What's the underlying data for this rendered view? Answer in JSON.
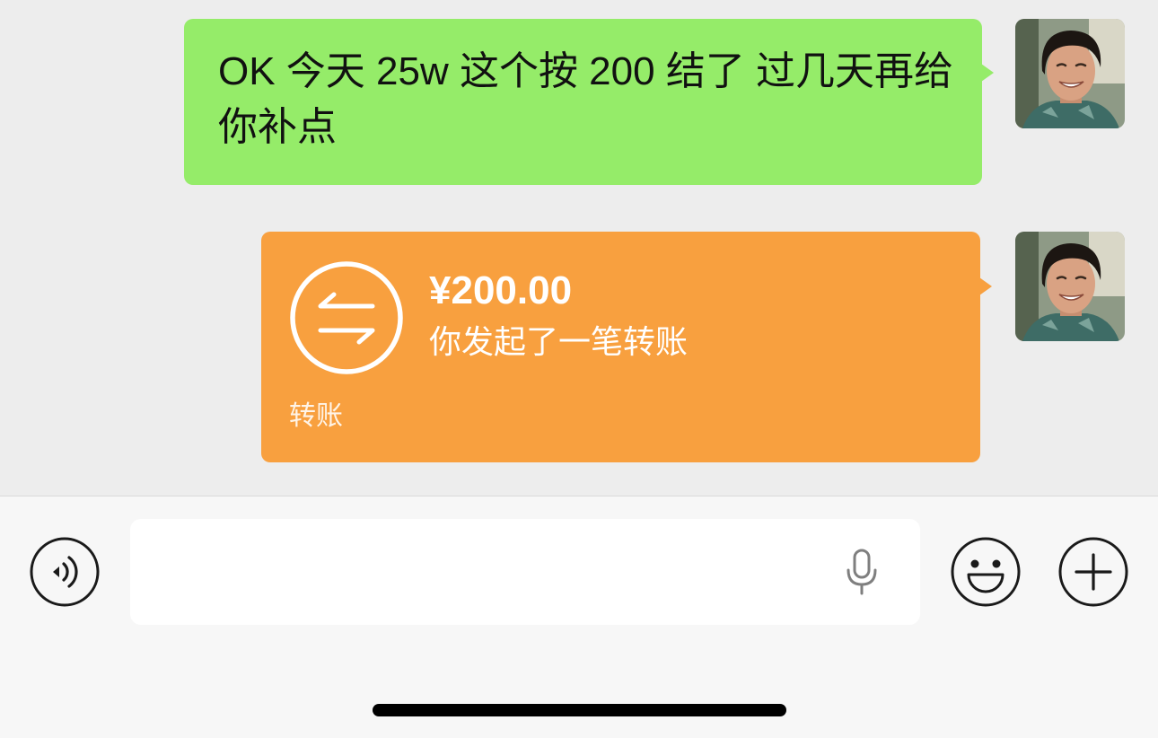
{
  "chat": {
    "text_message": {
      "text": "OK 今天 25w 这个按 200 结了 过几天再给你补点",
      "avatar_icon": "avatar-photo"
    },
    "transfer_message": {
      "amount": "¥200.00",
      "status": "你发起了一笔转账",
      "label": "转账",
      "icon": "transfer-icon",
      "avatar_icon": "avatar-photo"
    }
  },
  "input_bar": {
    "value": "",
    "left_icon": "voice-icon",
    "field_icon": "microphone-icon",
    "emoji_icon": "emoji-icon",
    "more_icon": "plus-icon"
  },
  "colors": {
    "chat_background": "#EDEDED",
    "outgoing_bubble": "#95EC69",
    "transfer_bubble": "#F8A03F",
    "input_bar_background": "#F7F7F7",
    "input_field": "#FFFFFF",
    "icon_color": "#1A1A1A",
    "mic_icon_color": "#7F7F7F"
  }
}
